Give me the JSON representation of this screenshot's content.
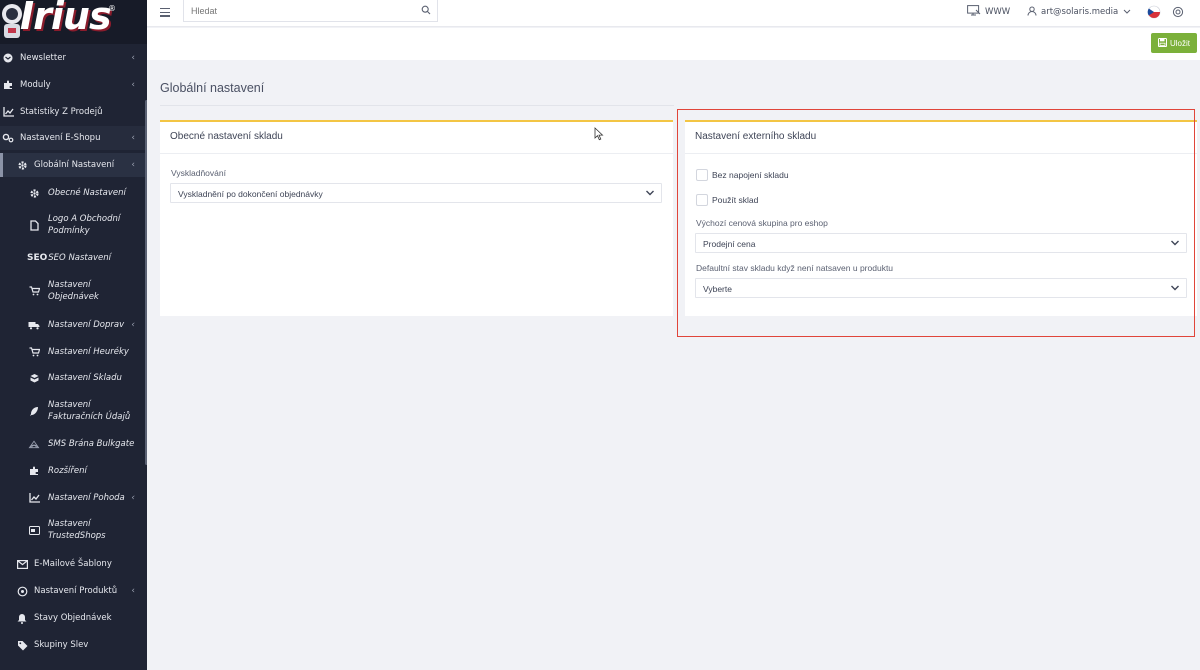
{
  "brand": {
    "logo_text": "Irius",
    "reg_mark": "®"
  },
  "sidebar": {
    "items": [
      {
        "label": "Newsletter",
        "icon": "newsletter-icon",
        "chev": "‹"
      },
      {
        "label": "Moduly",
        "icon": "puzzle-icon",
        "chev": "‹"
      },
      {
        "label": "Statistiky Z Prodejů",
        "icon": "chart-icon"
      },
      {
        "label": "Nastavení E-Shopu",
        "icon": "cogs-icon",
        "chev": "‹"
      },
      {
        "label": "Globální Nastavení",
        "icon": "gear-icon",
        "chev": "‹"
      },
      {
        "label": "Obecné Nastavení",
        "icon": "gear-icon"
      },
      {
        "label": "Logo A Obchodní Podmínky",
        "icon": "document-icon"
      },
      {
        "label": "SEO Nastavení",
        "icon": "seo-icon",
        "prefix": "SEO"
      },
      {
        "label": "Nastavení Objednávek",
        "icon": "cart-icon"
      },
      {
        "label": "Nastavení Doprav",
        "icon": "truck-icon",
        "chev": "‹"
      },
      {
        "label": "Nastavení Heuréky",
        "icon": "cart-icon"
      },
      {
        "label": "Nastavení Skladu",
        "icon": "boxes-icon"
      },
      {
        "label": "Nastavení Fakturačních Údajů",
        "icon": "feather-icon"
      },
      {
        "label": "SMS Brána Bulkgate",
        "icon": "broadcast-icon"
      },
      {
        "label": "Rozšíření",
        "icon": "puzzle-icon"
      },
      {
        "label": "Nastavení Pohoda",
        "icon": "chart-icon",
        "chev": "‹"
      },
      {
        "label": "Nastavení TrustedShops",
        "icon": "badge-icon"
      },
      {
        "label": "E-Mailové Šablony",
        "icon": "envelope-icon"
      },
      {
        "label": "Nastavení Produktů",
        "icon": "gear-icon",
        "chev": "‹"
      },
      {
        "label": "Stavy Objednávek",
        "icon": "bell-icon"
      },
      {
        "label": "Skupiny Slev",
        "icon": "tag-icon"
      }
    ]
  },
  "topbar": {
    "search_placeholder": "Hledat",
    "www_label": "WWW",
    "user_email": "art@solaris.media"
  },
  "toolbar": {
    "save_label": "Uložit"
  },
  "page": {
    "title": "Globální nastavení"
  },
  "panel_left": {
    "title": "Obecné nastavení skladu",
    "field_label": "Vyskladňování",
    "field_value": "Vyskladnění po dokončení objednávky"
  },
  "panel_right": {
    "title": "Nastavení externího skladu",
    "checkbox1": "Bez napojení skladu",
    "checkbox2": "Použít sklad",
    "field1_label": "Výchozí cenová skupina pro eshop",
    "field1_value": "Prodejní cena",
    "field2_label": "Defaultní stav skladu když není natsaven u produktu",
    "field2_value": "Vyberte"
  },
  "colors": {
    "sidebar_bg": "#1f2434",
    "accent_yellow": "#f3c544",
    "save_green": "#7bb03a",
    "highlight_red": "#e0453a"
  }
}
